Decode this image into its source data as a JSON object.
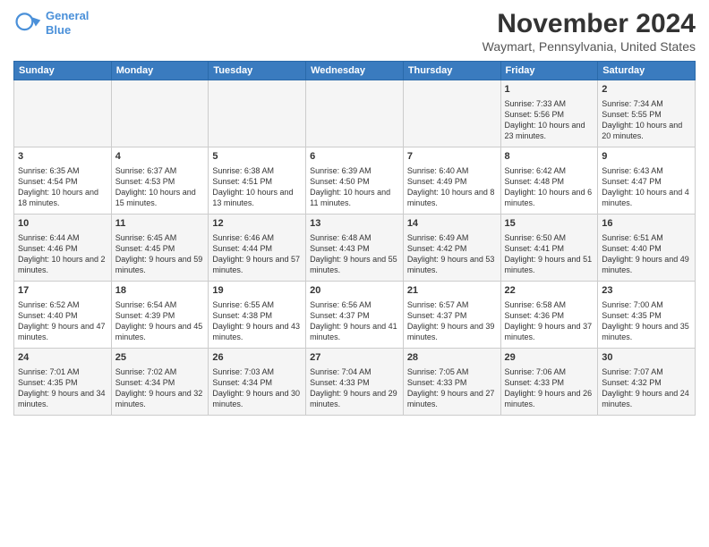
{
  "header": {
    "logo_line1": "General",
    "logo_line2": "Blue",
    "title": "November 2024",
    "subtitle": "Waymart, Pennsylvania, United States"
  },
  "days_of_week": [
    "Sunday",
    "Monday",
    "Tuesday",
    "Wednesday",
    "Thursday",
    "Friday",
    "Saturday"
  ],
  "weeks": [
    [
      {
        "day": "",
        "info": ""
      },
      {
        "day": "",
        "info": ""
      },
      {
        "day": "",
        "info": ""
      },
      {
        "day": "",
        "info": ""
      },
      {
        "day": "",
        "info": ""
      },
      {
        "day": "1",
        "info": "Sunrise: 7:33 AM\nSunset: 5:56 PM\nDaylight: 10 hours and 23 minutes."
      },
      {
        "day": "2",
        "info": "Sunrise: 7:34 AM\nSunset: 5:55 PM\nDaylight: 10 hours and 20 minutes."
      }
    ],
    [
      {
        "day": "3",
        "info": "Sunrise: 6:35 AM\nSunset: 4:54 PM\nDaylight: 10 hours and 18 minutes."
      },
      {
        "day": "4",
        "info": "Sunrise: 6:37 AM\nSunset: 4:53 PM\nDaylight: 10 hours and 15 minutes."
      },
      {
        "day": "5",
        "info": "Sunrise: 6:38 AM\nSunset: 4:51 PM\nDaylight: 10 hours and 13 minutes."
      },
      {
        "day": "6",
        "info": "Sunrise: 6:39 AM\nSunset: 4:50 PM\nDaylight: 10 hours and 11 minutes."
      },
      {
        "day": "7",
        "info": "Sunrise: 6:40 AM\nSunset: 4:49 PM\nDaylight: 10 hours and 8 minutes."
      },
      {
        "day": "8",
        "info": "Sunrise: 6:42 AM\nSunset: 4:48 PM\nDaylight: 10 hours and 6 minutes."
      },
      {
        "day": "9",
        "info": "Sunrise: 6:43 AM\nSunset: 4:47 PM\nDaylight: 10 hours and 4 minutes."
      }
    ],
    [
      {
        "day": "10",
        "info": "Sunrise: 6:44 AM\nSunset: 4:46 PM\nDaylight: 10 hours and 2 minutes."
      },
      {
        "day": "11",
        "info": "Sunrise: 6:45 AM\nSunset: 4:45 PM\nDaylight: 9 hours and 59 minutes."
      },
      {
        "day": "12",
        "info": "Sunrise: 6:46 AM\nSunset: 4:44 PM\nDaylight: 9 hours and 57 minutes."
      },
      {
        "day": "13",
        "info": "Sunrise: 6:48 AM\nSunset: 4:43 PM\nDaylight: 9 hours and 55 minutes."
      },
      {
        "day": "14",
        "info": "Sunrise: 6:49 AM\nSunset: 4:42 PM\nDaylight: 9 hours and 53 minutes."
      },
      {
        "day": "15",
        "info": "Sunrise: 6:50 AM\nSunset: 4:41 PM\nDaylight: 9 hours and 51 minutes."
      },
      {
        "day": "16",
        "info": "Sunrise: 6:51 AM\nSunset: 4:40 PM\nDaylight: 9 hours and 49 minutes."
      }
    ],
    [
      {
        "day": "17",
        "info": "Sunrise: 6:52 AM\nSunset: 4:40 PM\nDaylight: 9 hours and 47 minutes."
      },
      {
        "day": "18",
        "info": "Sunrise: 6:54 AM\nSunset: 4:39 PM\nDaylight: 9 hours and 45 minutes."
      },
      {
        "day": "19",
        "info": "Sunrise: 6:55 AM\nSunset: 4:38 PM\nDaylight: 9 hours and 43 minutes."
      },
      {
        "day": "20",
        "info": "Sunrise: 6:56 AM\nSunset: 4:37 PM\nDaylight: 9 hours and 41 minutes."
      },
      {
        "day": "21",
        "info": "Sunrise: 6:57 AM\nSunset: 4:37 PM\nDaylight: 9 hours and 39 minutes."
      },
      {
        "day": "22",
        "info": "Sunrise: 6:58 AM\nSunset: 4:36 PM\nDaylight: 9 hours and 37 minutes."
      },
      {
        "day": "23",
        "info": "Sunrise: 7:00 AM\nSunset: 4:35 PM\nDaylight: 9 hours and 35 minutes."
      }
    ],
    [
      {
        "day": "24",
        "info": "Sunrise: 7:01 AM\nSunset: 4:35 PM\nDaylight: 9 hours and 34 minutes."
      },
      {
        "day": "25",
        "info": "Sunrise: 7:02 AM\nSunset: 4:34 PM\nDaylight: 9 hours and 32 minutes."
      },
      {
        "day": "26",
        "info": "Sunrise: 7:03 AM\nSunset: 4:34 PM\nDaylight: 9 hours and 30 minutes."
      },
      {
        "day": "27",
        "info": "Sunrise: 7:04 AM\nSunset: 4:33 PM\nDaylight: 9 hours and 29 minutes."
      },
      {
        "day": "28",
        "info": "Sunrise: 7:05 AM\nSunset: 4:33 PM\nDaylight: 9 hours and 27 minutes."
      },
      {
        "day": "29",
        "info": "Sunrise: 7:06 AM\nSunset: 4:33 PM\nDaylight: 9 hours and 26 minutes."
      },
      {
        "day": "30",
        "info": "Sunrise: 7:07 AM\nSunset: 4:32 PM\nDaylight: 9 hours and 24 minutes."
      }
    ]
  ]
}
